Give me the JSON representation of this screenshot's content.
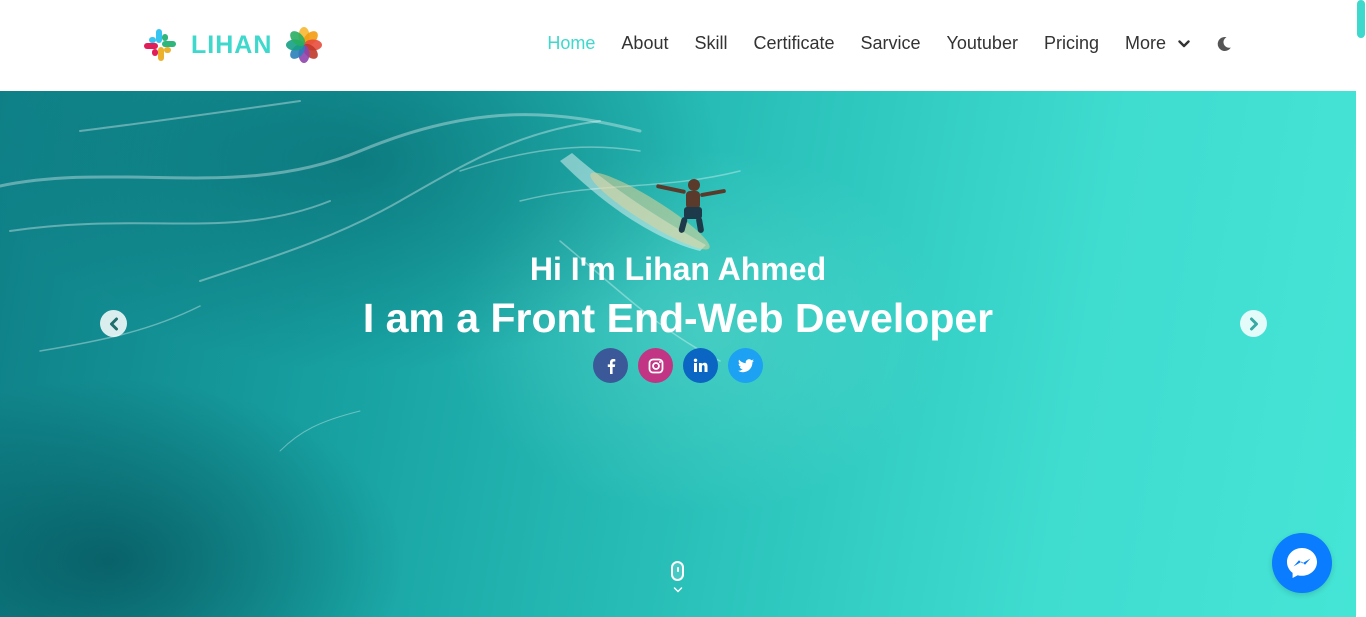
{
  "brand": {
    "name": "LIHAN",
    "icons": [
      "slack-logo-icon",
      "photos-flower-icon"
    ]
  },
  "nav": {
    "items": [
      {
        "label": "Home",
        "active": true
      },
      {
        "label": "About"
      },
      {
        "label": "Skill"
      },
      {
        "label": "Certificate"
      },
      {
        "label": "Sarvice"
      },
      {
        "label": "Youtuber"
      },
      {
        "label": "Pricing"
      }
    ],
    "more_label": "More",
    "theme_toggle_icon": "moon-icon"
  },
  "hero": {
    "greeting": "Hi I'm Lihan Ahmed",
    "role": "I am a Front End-Web Developer",
    "socials": [
      {
        "name": "facebook",
        "icon": "facebook-icon",
        "color": "#3b5998"
      },
      {
        "name": "instagram",
        "icon": "instagram-icon",
        "color": "#c13584"
      },
      {
        "name": "linkedin",
        "icon": "linkedin-icon",
        "color": "#0a66c2"
      },
      {
        "name": "twitter",
        "icon": "twitter-icon",
        "color": "#1da1f2"
      }
    ]
  },
  "colors": {
    "accent": "#3ed8cc",
    "nav_text": "#333333",
    "messenger": "#0a7cff"
  },
  "widgets": {
    "messenger_icon": "messenger-icon"
  }
}
